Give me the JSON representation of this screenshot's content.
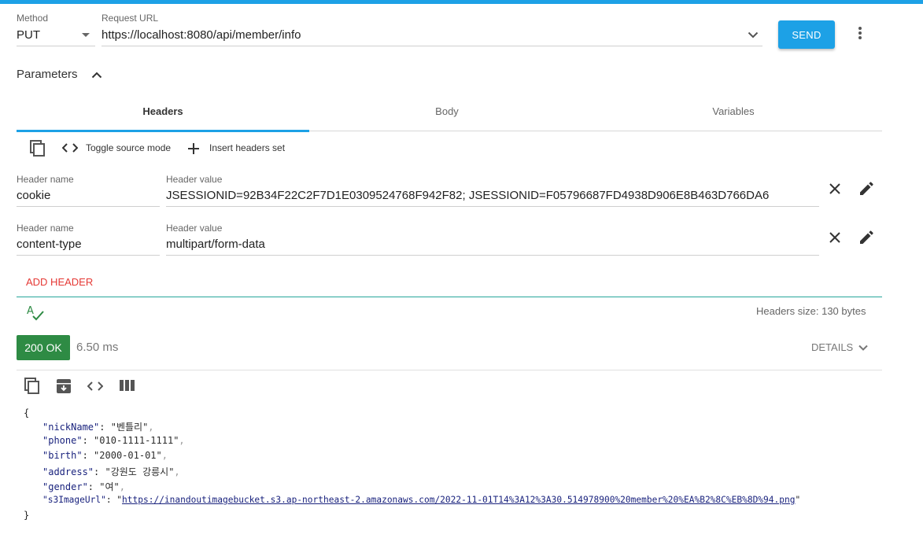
{
  "request": {
    "method_label": "Method",
    "method": "PUT",
    "url_label": "Request URL",
    "url": "https://localhost:8080/api/member/info",
    "send_label": "SEND"
  },
  "parameters": {
    "title": "Parameters",
    "tabs": [
      {
        "label": "Headers",
        "active": true
      },
      {
        "label": "Body",
        "active": false
      },
      {
        "label": "Variables",
        "active": false
      }
    ],
    "toolbar": {
      "toggle_source": "Toggle source mode",
      "insert_headers": "Insert headers set"
    },
    "headers": [
      {
        "name_label": "Header name",
        "name": "cookie",
        "value_label": "Header value",
        "value": "JSESSIONID=92B34F22C2F7D1E0309524768F942F82; JSESSIONID=F05796687FD4938D906E8B463D766DA6"
      },
      {
        "name_label": "Header name",
        "name": "content-type",
        "value_label": "Header value",
        "value": "multipart/form-data"
      }
    ],
    "add_header": "ADD HEADER",
    "headers_size": "Headers size: 130 bytes"
  },
  "response": {
    "status": "200 OK",
    "time": "6.50 ms",
    "details": "DETAILS",
    "status_color": "#2e8b44",
    "json": {
      "nickName": "벤틀리",
      "phone": "010-1111-1111",
      "birth": "2000-01-01",
      "address": "강원도 강릉시",
      "gender": "여",
      "s3ImageUrl": "https://inandoutimagebucket.s3.ap-northeast-2.amazonaws.com/2022-11-01T14%3A12%3A30.514978900%20member%20%EA%B2%8C%EB%8D%94.png"
    }
  },
  "colors": {
    "accent": "#1da1e6",
    "add_header": "#e53935",
    "teal_line": "#26a69a"
  }
}
